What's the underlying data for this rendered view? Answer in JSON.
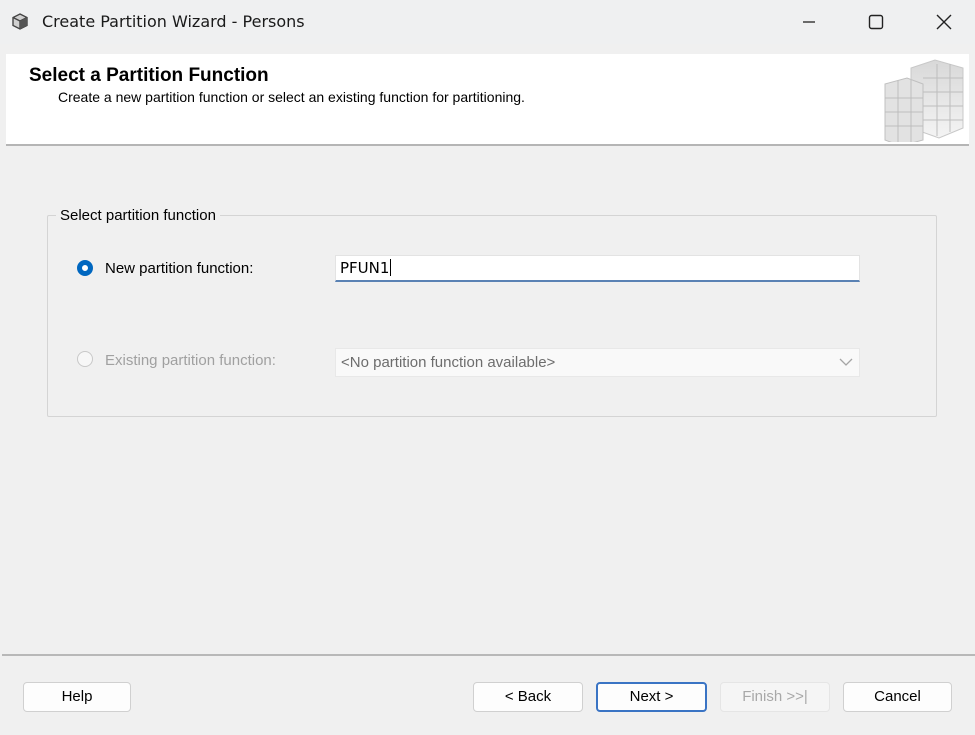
{
  "window": {
    "title": "Create Partition Wizard - Persons",
    "controls": [
      "minimize",
      "maximize",
      "close"
    ]
  },
  "header": {
    "title": "Select a Partition Function",
    "subtitle": "Create a new partition function or select an existing function for partitioning."
  },
  "group": {
    "label": "Select partition function",
    "new_option": {
      "label": "New partition function:",
      "selected": true,
      "value": "PFUN1"
    },
    "existing_option": {
      "label": "Existing partition function:",
      "selected": false,
      "enabled": false,
      "value": "<No partition function available>"
    }
  },
  "buttons": {
    "help": "Help",
    "back": "< Back",
    "next": "Next >",
    "finish": "Finish >>|",
    "cancel": "Cancel"
  },
  "colors": {
    "accent": "#0067c0",
    "focus_border": "#3a74c4"
  }
}
